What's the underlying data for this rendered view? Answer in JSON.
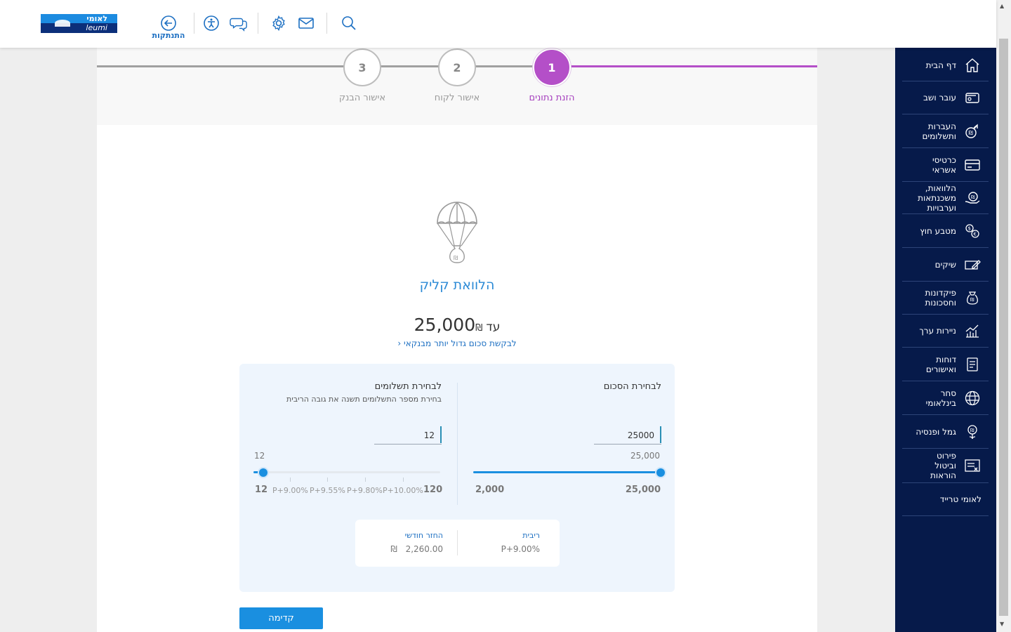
{
  "header": {
    "logo_he": "לאומי",
    "logo_en": "leumi",
    "logout_label": "התנתקות",
    "icons": [
      "logout-icon",
      "accessibility-icon",
      "chat-icon",
      "settings-icon",
      "mail-icon",
      "search-icon"
    ]
  },
  "sidebar": {
    "items": [
      {
        "label": "דף הבית",
        "icon": "home-icon"
      },
      {
        "label": "עובר ושב",
        "icon": "wallet-icon"
      },
      {
        "label": "העברות ותשלומים",
        "icon": "transfer-icon"
      },
      {
        "label": "כרטיסי אשראי",
        "icon": "credit-card-icon"
      },
      {
        "label": "הלוואות, משכנתאות וערבויות",
        "icon": "loan-icon"
      },
      {
        "label": "מטבע חוץ",
        "icon": "currency-icon"
      },
      {
        "label": "שיקים",
        "icon": "cheque-icon"
      },
      {
        "label": "פיקדונות וחסכונות",
        "icon": "savings-icon"
      },
      {
        "label": "ניירות ערך",
        "icon": "securities-icon"
      },
      {
        "label": "דוחות ואישורים",
        "icon": "reports-icon"
      },
      {
        "label": "סחר בינלאומי",
        "icon": "globe-icon"
      },
      {
        "label": "גמל ופנסיה",
        "icon": "pension-icon"
      },
      {
        "label": "פירוט וביטול הוראות",
        "icon": "orders-icon"
      },
      {
        "label": "לאומי טרייד",
        "icon": ""
      }
    ]
  },
  "steps": [
    {
      "num": "1",
      "label": "הזנת נתונים"
    },
    {
      "num": "2",
      "label": "אישור לקוח"
    },
    {
      "num": "3",
      "label": "אישור הבנק"
    }
  ],
  "product": {
    "title": "הלוואת קליק",
    "amount_prefix": "עד",
    "amount": "25,000",
    "currency": "₪",
    "bigger_link": "לבקשת סכום גדול יותר מבנקאי",
    "bigger_chevron": "‹"
  },
  "amount_section": {
    "title": "לבחירת הסכום",
    "input_value": "25000",
    "current_value": "25,000",
    "min_label": "2,000",
    "max_label": "25,000",
    "fraction": 1.0
  },
  "payments_section": {
    "title": "לבחירת תשלומים",
    "subtitle": "בחירת מספר התשלומים תשנה את גובה הריבית",
    "input_value": "12",
    "current_value": "12",
    "min_label": "12",
    "max_label": "120",
    "rates": [
      "P+9.00%",
      "P+9.55%",
      "P+9.80%",
      "P+10.00%"
    ],
    "fraction": 0.0
  },
  "result": {
    "rate_title": "ריבית",
    "rate_value": "P+9.00%",
    "monthly_title": "החזר חודשי",
    "monthly_value": "2,260.00",
    "monthly_currency": "₪"
  },
  "next_button": "קדימה",
  "colors": {
    "primary": "#1a8fe0",
    "active_step": "#b44fc8",
    "sidebar_bg": "#061a4a"
  }
}
